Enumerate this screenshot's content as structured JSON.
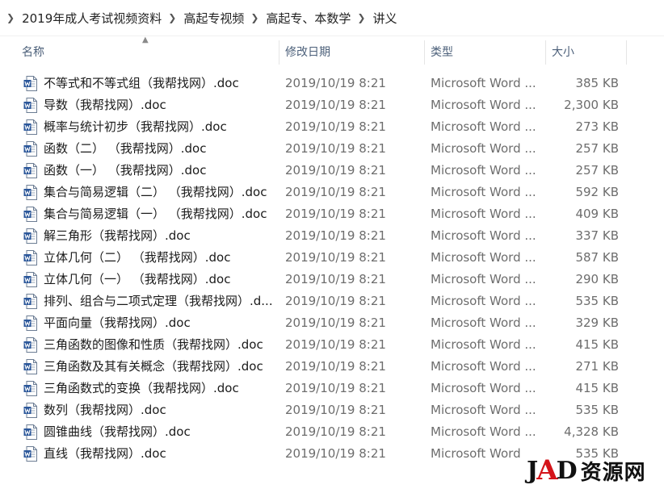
{
  "breadcrumb": [
    "2019年成人考试视频资料",
    "高起专视频",
    "高起专、本数学",
    "讲义"
  ],
  "columns": {
    "name": "名称",
    "date": "修改日期",
    "type": "类型",
    "size": "大小"
  },
  "files": [
    {
      "name": "不等式和不等式组（我帮找网）.doc",
      "date": "2019/10/19 8:21",
      "type": "Microsoft Word ...",
      "size": "385 KB"
    },
    {
      "name": "导数（我帮找网）.doc",
      "date": "2019/10/19 8:21",
      "type": "Microsoft Word ...",
      "size": "2,300 KB"
    },
    {
      "name": "概率与统计初步（我帮找网）.doc",
      "date": "2019/10/19 8:21",
      "type": "Microsoft Word ...",
      "size": "273 KB"
    },
    {
      "name": "函数（二） （我帮找网）.doc",
      "date": "2019/10/19 8:21",
      "type": "Microsoft Word ...",
      "size": "257 KB"
    },
    {
      "name": "函数（一） （我帮找网）.doc",
      "date": "2019/10/19 8:21",
      "type": "Microsoft Word ...",
      "size": "257 KB"
    },
    {
      "name": "集合与简易逻辑（二） （我帮找网）.doc",
      "date": "2019/10/19 8:21",
      "type": "Microsoft Word ...",
      "size": "592 KB"
    },
    {
      "name": "集合与简易逻辑（一） （我帮找网）.doc",
      "date": "2019/10/19 8:21",
      "type": "Microsoft Word ...",
      "size": "409 KB"
    },
    {
      "name": "解三角形（我帮找网）.doc",
      "date": "2019/10/19 8:21",
      "type": "Microsoft Word ...",
      "size": "337 KB"
    },
    {
      "name": "立体几何（二） （我帮找网）.doc",
      "date": "2019/10/19 8:21",
      "type": "Microsoft Word ...",
      "size": "587 KB"
    },
    {
      "name": "立体几何（一） （我帮找网）.doc",
      "date": "2019/10/19 8:21",
      "type": "Microsoft Word ...",
      "size": "290 KB"
    },
    {
      "name": "排列、组合与二项式定理（我帮找网）.d...",
      "date": "2019/10/19 8:21",
      "type": "Microsoft Word ...",
      "size": "535 KB"
    },
    {
      "name": "平面向量（我帮找网）.doc",
      "date": "2019/10/19 8:21",
      "type": "Microsoft Word ...",
      "size": "329 KB"
    },
    {
      "name": "三角函数的图像和性质（我帮找网）.doc",
      "date": "2019/10/19 8:21",
      "type": "Microsoft Word ...",
      "size": "415 KB"
    },
    {
      "name": "三角函数及其有关概念（我帮找网）.doc",
      "date": "2019/10/19 8:21",
      "type": "Microsoft Word ...",
      "size": "271 KB"
    },
    {
      "name": "三角函数式的变换（我帮找网）.doc",
      "date": "2019/10/19 8:21",
      "type": "Microsoft Word ...",
      "size": "415 KB"
    },
    {
      "name": "数列（我帮找网）.doc",
      "date": "2019/10/19 8:21",
      "type": "Microsoft Word ...",
      "size": "535 KB"
    },
    {
      "name": "圆锥曲线（我帮找网）.doc",
      "date": "2019/10/19 8:21",
      "type": "Microsoft Word ...",
      "size": "4,328 KB"
    },
    {
      "name": "直线（我帮找网）.doc",
      "date": "2019/10/19 8:21",
      "type": "Microsoft Word",
      "size": "535 KB"
    }
  ],
  "watermark": {
    "logo": "JAD",
    "text": "资源网"
  },
  "colors": {
    "word_blue": "#2b579a",
    "header_text": "#4c607a",
    "detail_text": "#6d6d6d"
  }
}
